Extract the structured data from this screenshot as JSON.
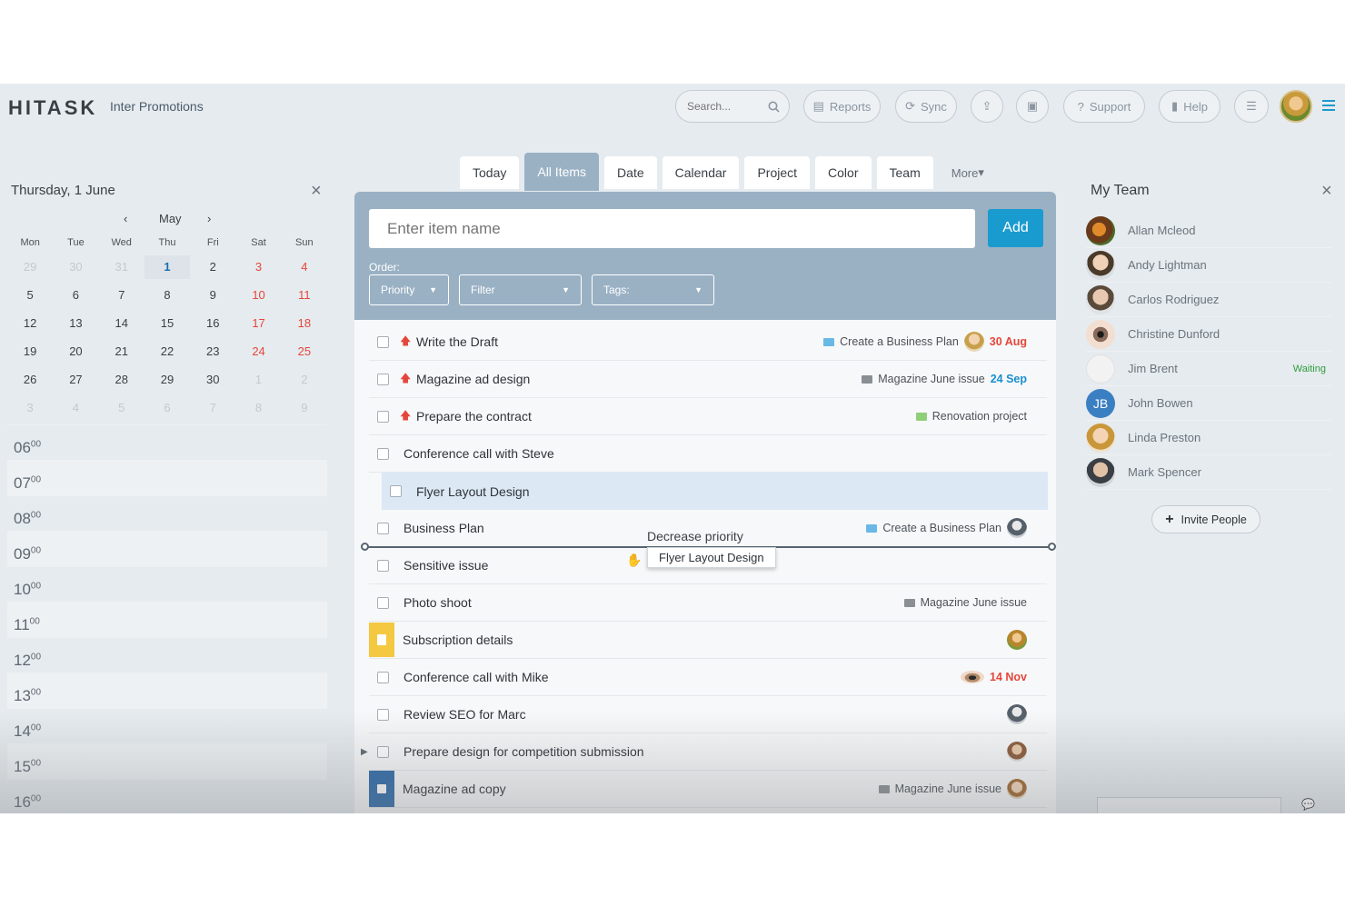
{
  "header": {
    "logo": "HITASK",
    "workspace": "Inter Promotions",
    "search_placeholder": "Search...",
    "buttons": {
      "reports": "Reports",
      "sync": "Sync",
      "support": "Support",
      "help": "Help"
    }
  },
  "calendar": {
    "title": "Thursday, 1 June",
    "month": "May",
    "weekdays": [
      "Mon",
      "Tue",
      "Wed",
      "Thu",
      "Fri",
      "Sat",
      "Sun"
    ],
    "weeks": [
      [
        "29",
        "30",
        "31",
        "1",
        "2",
        "3",
        "4"
      ],
      [
        "5",
        "6",
        "7",
        "8",
        "9",
        "10",
        "11"
      ],
      [
        "12",
        "13",
        "14",
        "15",
        "16",
        "17",
        "18"
      ],
      [
        "19",
        "20",
        "21",
        "22",
        "23",
        "24",
        "25"
      ],
      [
        "26",
        "27",
        "28",
        "29",
        "30",
        "1",
        "2"
      ],
      [
        "3",
        "4",
        "5",
        "6",
        "7",
        "8",
        "9"
      ]
    ],
    "hours": [
      "06",
      "07",
      "08",
      "09",
      "10",
      "11",
      "12",
      "13",
      "14",
      "15",
      "16"
    ],
    "minutes": "00"
  },
  "tabs": [
    "Today",
    "All Items",
    "Date",
    "Calendar",
    "Project",
    "Color",
    "Team"
  ],
  "tabs_more": "More",
  "active_tab": "All Items",
  "new_item": {
    "placeholder": "Enter item name",
    "add_label": "Add"
  },
  "order": {
    "label": "Order:",
    "priority": "Priority",
    "filter": "Filter",
    "tags": "Tags:"
  },
  "items": [
    {
      "name": "Write the Draft",
      "priority": true,
      "project": "Create a Business Plan",
      "date": "30 Aug"
    },
    {
      "name": "Magazine ad design",
      "priority": true,
      "project": "Magazine June issue",
      "date": "24 Sep"
    },
    {
      "name": "Prepare the contract",
      "priority": true,
      "project": "Renovation project"
    },
    {
      "name": "Conference call with Steve"
    },
    {
      "name": "Flyer Layout Design"
    },
    {
      "name": "Business Plan",
      "project": "Create a Business Plan"
    },
    {
      "name": "Sensitive issue"
    },
    {
      "name": "Photo shoot",
      "project": "Magazine June issue"
    },
    {
      "name": "Subscription details"
    },
    {
      "name": "Conference call with Mike",
      "date": "14 Nov"
    },
    {
      "name": "Review SEO for Marc"
    },
    {
      "name": "Prepare design for competition submission"
    },
    {
      "name": "Magazine ad copy",
      "project": "Magazine June issue"
    }
  ],
  "drag": {
    "hint": "Decrease priority",
    "dragged_item": "Flyer Layout Design"
  },
  "team": {
    "title": "My Team",
    "members": [
      {
        "name": "Allan Mcleod"
      },
      {
        "name": "Andy Lightman"
      },
      {
        "name": "Carlos Rodriguez"
      },
      {
        "name": "Christine Dunford"
      },
      {
        "name": "Jim Brent",
        "status": "Waiting"
      },
      {
        "name": "John Bowen",
        "initials": "JB"
      },
      {
        "name": "Linda Preston"
      },
      {
        "name": "Mark Spencer"
      }
    ],
    "invite_label": "Invite People"
  },
  "colors": {
    "accent": "#1a9bd0",
    "panel": "#9ab1c4",
    "priority": "#e5463b",
    "date_blue": "#1a8fd0",
    "waiting": "#2e9e3e"
  }
}
